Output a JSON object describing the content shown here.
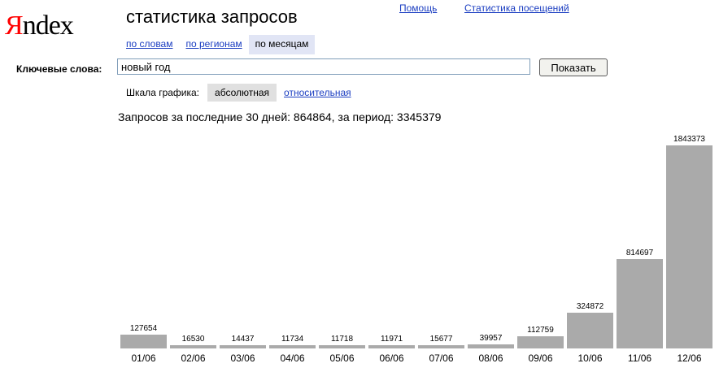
{
  "logo": {
    "first_letter": "Я",
    "rest": "ndex"
  },
  "page_title": "статистика запросов",
  "top_links": {
    "help": "Помощь",
    "visit_stats": "Статистика посещений"
  },
  "tabs": [
    {
      "label": "по словам",
      "active": false
    },
    {
      "label": "по регионам",
      "active": false
    },
    {
      "label": "по месяцам",
      "active": true
    }
  ],
  "keywords": {
    "label": "Ключевые слова:",
    "value": "новый год"
  },
  "show_button": "Показать",
  "scale": {
    "label": "Шкала графика:",
    "options": [
      {
        "label": "абсолютная",
        "active": true
      },
      {
        "label": "относительная",
        "active": false
      }
    ]
  },
  "summary": {
    "last30_label": "Запросов за последние 30 дней:",
    "last30_value": "864864",
    "period_label": ", за период:",
    "period_value": "3345379"
  },
  "colors": {
    "bar": "#aaaaaa",
    "link": "#1a3dc1",
    "active_tab": "#e1e5f5",
    "logo_accent": "#ff0000"
  },
  "chart_data": {
    "type": "bar",
    "categories": [
      "01/06",
      "02/06",
      "03/06",
      "04/06",
      "05/06",
      "06/06",
      "07/06",
      "08/06",
      "09/06",
      "10/06",
      "11/06",
      "12/06"
    ],
    "values": [
      127654,
      16530,
      14437,
      11734,
      11718,
      11971,
      15677,
      39957,
      112759,
      324872,
      814697,
      1843373
    ],
    "data_labels": [
      "127654",
      "16530",
      "14437",
      "11734",
      "11718",
      "11971",
      "15677",
      "39957",
      "112759",
      "324872",
      "814697",
      "1843373"
    ],
    "title": "",
    "xlabel": "",
    "ylabel": "",
    "ylim": [
      0,
      1843373
    ],
    "grid": false,
    "legend": "none"
  }
}
